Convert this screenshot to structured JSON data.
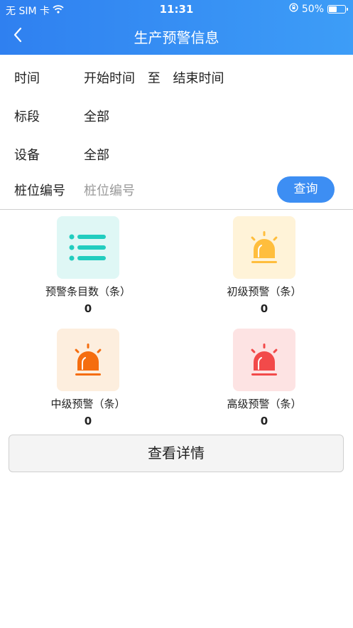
{
  "status_bar": {
    "carrier": "无 SIM 卡",
    "time": "11:31",
    "battery": "50%",
    "battery_level": 0.5
  },
  "nav": {
    "title": "生产预警信息"
  },
  "form": {
    "time_label": "时间",
    "start_time": "开始时间",
    "to": "至",
    "end_time": "结束时间",
    "section_label": "标段",
    "section_value": "全部",
    "device_label": "设备",
    "device_value": "全部",
    "pile_label": "桩位编号",
    "pile_placeholder": "桩位编号",
    "query_button": "查询"
  },
  "stats": [
    {
      "label": "预警条目数（条）",
      "count": "0",
      "icon": "list-icon",
      "bg": "#dff7f5",
      "color": "#22cdbf"
    },
    {
      "label": "初级预警（条）",
      "count": "0",
      "icon": "alarm-icon",
      "bg": "#fff3d8",
      "color": "#ffbe3d"
    },
    {
      "label": "中级预警（条）",
      "count": "0",
      "icon": "alarm-icon",
      "bg": "#fdeede",
      "color": "#f56d0f"
    },
    {
      "label": "高级预警（条）",
      "count": "0",
      "icon": "alarm-icon",
      "bg": "#fde3e3",
      "color": "#f24a4a"
    }
  ],
  "detail_button": "查看详情"
}
